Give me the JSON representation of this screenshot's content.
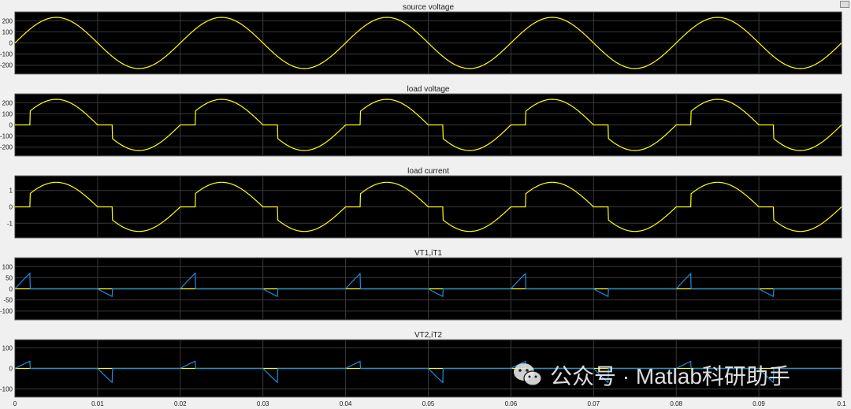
{
  "window": {
    "watermark_text": "公众号 · Matlab科研助手",
    "watermark_icon": "wechat-icon"
  },
  "colors": {
    "background": "#f0f0f0",
    "axes_bg": "#000000",
    "grid": "#3a3a3a",
    "tick_text": "#1a1a1a",
    "yellow": "#ffff00",
    "blue": "#1a8fe3"
  },
  "chart_data": [
    {
      "type": "line",
      "title": "source voltage",
      "xlim": [
        0,
        0.1
      ],
      "ylim": [
        -280,
        280
      ],
      "yticks": [
        200,
        100,
        0,
        -100,
        -200
      ],
      "ytick_labels": [
        "200",
        "100",
        "0",
        "-100",
        "-200"
      ],
      "grid": true,
      "series": [
        {
          "color": "#ffff00",
          "desc": "v = 230·sin(2π·50·t)",
          "amplitude": 230,
          "frequency_hz": 50,
          "firing_delay_s": 0
        }
      ]
    },
    {
      "type": "line",
      "title": "load voltage",
      "xlim": [
        0,
        0.1
      ],
      "ylim": [
        -280,
        280
      ],
      "yticks": [
        200,
        100,
        0,
        -100,
        -200
      ],
      "ytick_labels": [
        "200",
        "100",
        "0",
        "-100",
        "-200"
      ],
      "grid": true,
      "series": [
        {
          "color": "#ffff00",
          "desc": "phase-controlled sine, zero between zero-crossing and firing",
          "amplitude": 230,
          "frequency_hz": 50,
          "firing_delay_s": 0.0018
        }
      ]
    },
    {
      "type": "line",
      "title": "load current",
      "xlim": [
        0,
        0.1
      ],
      "ylim": [
        -1.9,
        1.9
      ],
      "yticks": [
        1,
        0,
        -1
      ],
      "ytick_labels": [
        "1",
        "0",
        "-1"
      ],
      "grid": true,
      "series": [
        {
          "color": "#ffff00",
          "desc": "phase-controlled sine current",
          "amplitude": 1.5,
          "frequency_hz": 50,
          "firing_delay_s": 0.0018
        }
      ]
    },
    {
      "type": "line",
      "title": "VT1,iT1",
      "xlim": [
        0,
        0.1
      ],
      "ylim": [
        -140,
        140
      ],
      "yticks": [
        100,
        50,
        0,
        -50,
        -100
      ],
      "ytick_labels": [
        "100",
        "50",
        "0",
        "-50",
        "-100"
      ],
      "grid": true,
      "series": [
        {
          "color": "#ffff00",
          "desc": "iT1 thyristor current (near zero at this scale)",
          "amplitude": 1.5,
          "frequency_hz": 50,
          "firing_delay_s": 0.0018
        },
        {
          "color": "#1a8fe3",
          "desc": "VT1 thyristor voltage during blocking",
          "amplitude": 230,
          "frequency_hz": 50,
          "firing_delay_s": 0.0018
        }
      ]
    },
    {
      "type": "line",
      "title": "VT2,iT2",
      "xlim": [
        0,
        0.1
      ],
      "ylim": [
        -140,
        140
      ],
      "yticks": [
        100,
        0,
        -100
      ],
      "ytick_labels": [
        "100",
        "0",
        "-100"
      ],
      "grid": true,
      "series": [
        {
          "color": "#ffff00",
          "desc": "iT2 thyristor current (near zero at this scale)",
          "amplitude": 1.5,
          "frequency_hz": 50,
          "firing_delay_s": 0.0018
        },
        {
          "color": "#1a8fe3",
          "desc": "VT2 thyristor voltage during blocking",
          "amplitude": 230,
          "frequency_hz": 50,
          "firing_delay_s": 0.0018
        }
      ]
    }
  ],
  "x_axis": {
    "ticks": [
      0,
      0.01,
      0.02,
      0.03,
      0.04,
      0.05,
      0.06,
      0.07,
      0.08,
      0.09,
      0.1
    ],
    "tick_labels": [
      "0",
      "0.01",
      "0.02",
      "0.03",
      "0.04",
      "0.05",
      "0.06",
      "0.07",
      "0.08",
      "0.09",
      "0.1"
    ]
  }
}
